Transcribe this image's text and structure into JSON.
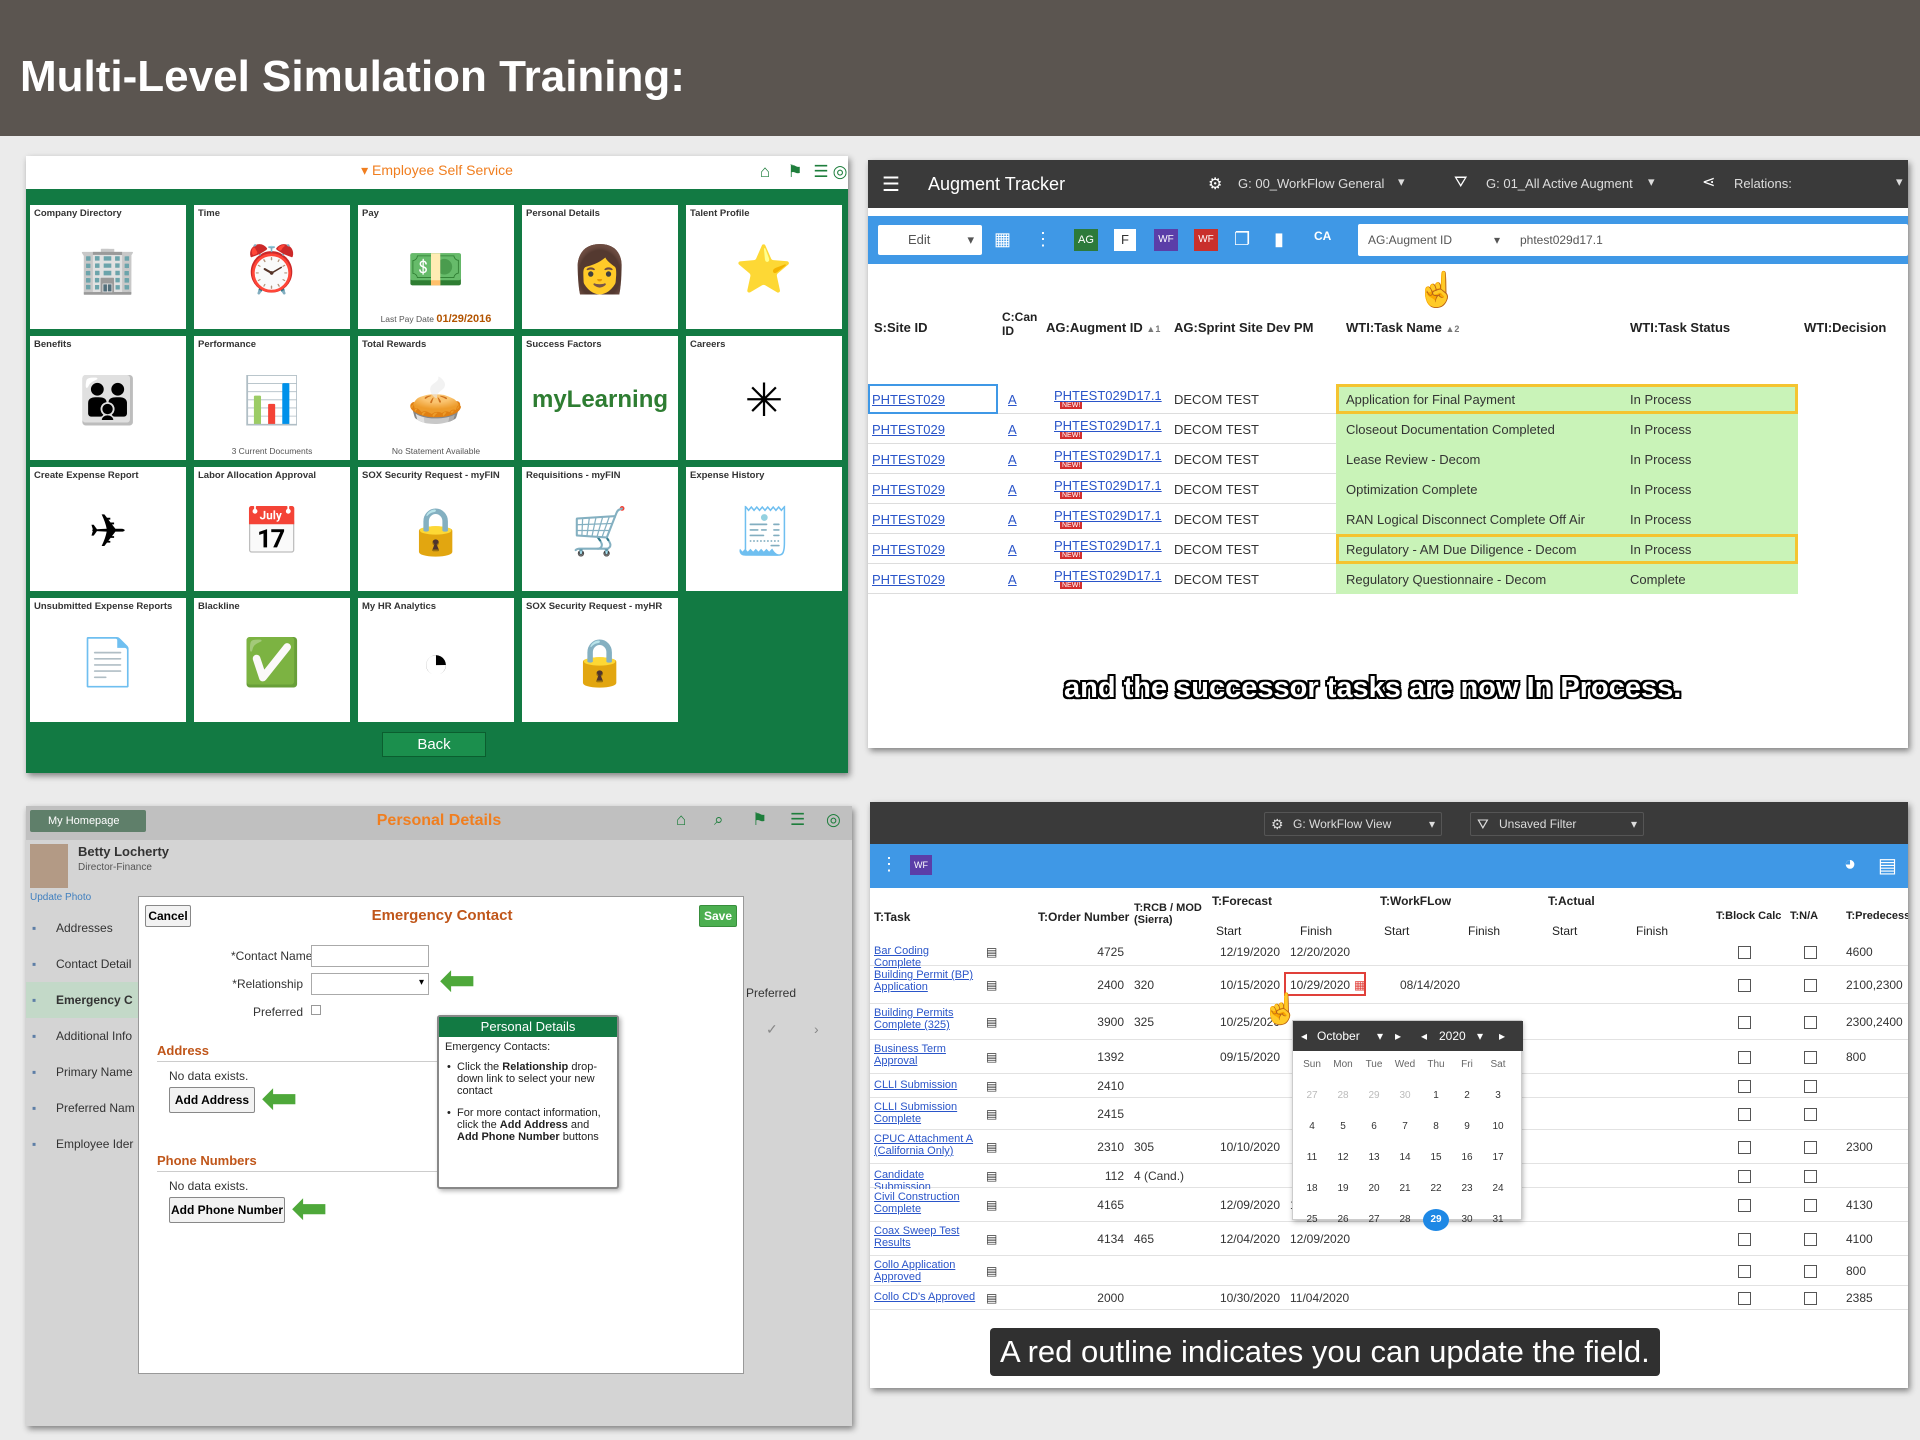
{
  "header": {
    "title": "Multi-Level Simulation Training:"
  },
  "p1": {
    "section_title": "▾ Employee Self Service",
    "header_icons": [
      "home-icon",
      "flag-icon",
      "menu-icon",
      "compass-icon"
    ],
    "tiles": [
      {
        "title": "Company Directory",
        "icon": "org-chart-icon",
        "glyph": "🏢"
      },
      {
        "title": "Time",
        "icon": "person-clock-icon",
        "glyph": "⏰"
      },
      {
        "title": "Pay",
        "icon": "money-icon",
        "glyph": "💵",
        "footer": "Last Pay Date",
        "footer_value": "01/29/2016"
      },
      {
        "title": "Personal Details",
        "icon": "photo-icon",
        "glyph": "👩"
      },
      {
        "title": "Talent Profile",
        "icon": "person-star-icon",
        "glyph": "⭐"
      },
      {
        "title": "Benefits",
        "icon": "benefits-icon",
        "glyph": "👪"
      },
      {
        "title": "Performance",
        "icon": "performance-icon",
        "glyph": "📊",
        "footer": "3 Current Documents"
      },
      {
        "title": "Total Rewards",
        "icon": "pie-chart-icon",
        "glyph": "🥧",
        "footer": "No Statement Available"
      },
      {
        "title": "Success Factors",
        "icon": "mylearning-logo",
        "glyph": "",
        "logo_text": "myLearning"
      },
      {
        "title": "Careers",
        "icon": "careers-icon",
        "glyph": "✳"
      },
      {
        "title": "Create Expense Report",
        "icon": "travel-icon",
        "glyph": "✈"
      },
      {
        "title": "Labor Allocation Approval",
        "icon": "calendar-icon",
        "glyph": "📅"
      },
      {
        "title": "SOX Security Request - myFIN",
        "icon": "lock-icon",
        "glyph": "🔒"
      },
      {
        "title": "Requisitions - myFIN",
        "icon": "cart-icon",
        "glyph": "🛒"
      },
      {
        "title": "Expense History",
        "icon": "expense-history-icon",
        "glyph": "🧾"
      },
      {
        "title": "Unsubmitted Expense Reports",
        "icon": "document-info-icon",
        "glyph": "📄"
      },
      {
        "title": "Blackline",
        "icon": "checklist-icon",
        "glyph": "✅"
      },
      {
        "title": "My HR Analytics",
        "icon": "pie-chart-icon",
        "glyph": "◔"
      },
      {
        "title": "SOX Security Request - myHR",
        "icon": "lock-icon",
        "glyph": "🔒"
      }
    ],
    "back_label": "Back"
  },
  "p2": {
    "app_title": "Augment Tracker",
    "view_dd": "G: 00_WorkFlow General",
    "filter_dd": "G: 01_All Active Augment",
    "relations_dd": "Relations:",
    "edit_label": "Edit",
    "search_field": "AG:Augment ID",
    "search_value": "phtest029d17.1",
    "columns": [
      "S:Site ID",
      "C:Can ID",
      "AG:Augment ID",
      "AG:Sprint Site Dev PM",
      "WTI:Task Name",
      "WTI:Task Status",
      "WTI:Decision"
    ],
    "sort_marks": {
      "augment": "▲1",
      "task": "▲2"
    },
    "new_badge": "NEW!",
    "rows": [
      {
        "site": "PHTEST029",
        "can": "A",
        "augment": "PHTEST029D17.1",
        "pm": "DECOM TEST",
        "task": "Application for Final Payment",
        "status": "In Process"
      },
      {
        "site": "PHTEST029",
        "can": "A",
        "augment": "PHTEST029D17.1",
        "pm": "DECOM TEST",
        "task": "Closeout Documentation Completed",
        "status": "In Process"
      },
      {
        "site": "PHTEST029",
        "can": "A",
        "augment": "PHTEST029D17.1",
        "pm": "DECOM TEST",
        "task": "Lease Review - Decom",
        "status": "In Process"
      },
      {
        "site": "PHTEST029",
        "can": "A",
        "augment": "PHTEST029D17.1",
        "pm": "DECOM TEST",
        "task": "Optimization Complete",
        "status": "In Process"
      },
      {
        "site": "PHTEST029",
        "can": "A",
        "augment": "PHTEST029D17.1",
        "pm": "DECOM TEST",
        "task": "RAN Logical Disconnect Complete Off Air",
        "status": "In Process"
      },
      {
        "site": "PHTEST029",
        "can": "A",
        "augment": "PHTEST029D17.1",
        "pm": "DECOM TEST",
        "task": "Regulatory - AM Due Diligence - Decom",
        "status": "In Process"
      },
      {
        "site": "PHTEST029",
        "can": "A",
        "augment": "PHTEST029D17.1",
        "pm": "DECOM TEST",
        "task": "Regulatory Questionnaire - Decom",
        "status": "Complete"
      }
    ],
    "caption": "and the successor tasks are now In Process."
  },
  "p3": {
    "homepage": "My Homepage",
    "page_title": "Personal Details",
    "user_name": "Betty Locherty",
    "user_title": "Director-Finance",
    "update_photo": "Update Photo",
    "nav": [
      "Addresses",
      "Contact Detail",
      "Emergency C",
      "Additional Info",
      "Primary Name",
      "Preferred Nam",
      "Employee Ider"
    ],
    "modal_title": "Emergency Contact",
    "cancel": "Cancel",
    "save": "Save",
    "contact_name_label": "*Contact Name",
    "relationship_label": "*Relationship",
    "preferred_label": "Preferred",
    "address_section": "Address",
    "no_data": "No data exists.",
    "add_address": "Add Address",
    "phone_section": "Phone Numbers",
    "add_phone": "Add Phone Number",
    "bg_preferred": "Preferred",
    "tip_title": "Personal Details",
    "tip_heading": "Emergency Contacts:",
    "tip_b1_pre": "Click the ",
    "tip_b1_bold": "Relationship",
    "tip_b1_post": " drop-down link to select your new contact",
    "tip_b2_pre": "For more contact information, click the ",
    "tip_b2_bold1": "Add Address",
    "tip_b2_mid": " and ",
    "tip_b2_bold2": "Add Phone Number",
    "tip_b2_post": " buttons"
  },
  "p4": {
    "view_dd": "G: WorkFlow View",
    "filter_dd": "Unsaved Filter",
    "col_task": "T:Task",
    "col_order": "T:Order Number",
    "col_rcb": "T:RCB / MOD (Sierra)",
    "grp_forecast": "T:Forecast",
    "grp_workflow": "T:WorkFLow",
    "grp_actual": "T:Actual",
    "sub_start": "Start",
    "sub_finish": "Finish",
    "col_block": "T:Block Calc",
    "col_na": "T:N/A",
    "col_pred": "T:Predecess",
    "rows": [
      {
        "task": "Bar Coding Complete",
        "order": "4725",
        "rcb": "",
        "fstart": "12/19/2020",
        "ffinish": "12/20/2020",
        "wstart": "",
        "pred": "4600"
      },
      {
        "task": "Building Permit (BP) Application",
        "order": "2400",
        "rcb": "320",
        "fstart": "10/15/2020",
        "ffinish": "10/29/2020",
        "wstart": "08/14/2020",
        "pred": "2100,2300"
      },
      {
        "task": "Building Permits Complete (325)",
        "order": "3900",
        "rcb": "325",
        "fstart": "10/25/2020",
        "ffinish": "",
        "wstart": "",
        "pred": "2300,2400"
      },
      {
        "task": "Business Term Approval",
        "order": "1392",
        "rcb": "",
        "fstart": "09/15/2020",
        "ffinish": "",
        "wstart": "",
        "pred": "800"
      },
      {
        "task": "CLLI Submission",
        "order": "2410",
        "rcb": "",
        "fstart": "",
        "ffinish": "",
        "wstart": "",
        "pred": ""
      },
      {
        "task": "CLLI Submission Complete",
        "order": "2415",
        "rcb": "",
        "fstart": "",
        "ffinish": "",
        "wstart": "",
        "pred": ""
      },
      {
        "task": "CPUC Attachment A (California Only)",
        "order": "2310",
        "rcb": "305",
        "fstart": "10/10/2020",
        "ffinish": "",
        "wstart": "",
        "pred": "2300"
      },
      {
        "task": "Candidate Submission",
        "order": "112",
        "rcb": "4 (Cand.)",
        "fstart": "",
        "ffinish": "",
        "wstart": "",
        "pred": ""
      },
      {
        "task": "Civil Construction Complete",
        "order": "4165",
        "rcb": "",
        "fstart": "12/09/2020",
        "ffinish": "12/09/2020",
        "wstart": "",
        "pred": "4130"
      },
      {
        "task": "Coax Sweep Test Results",
        "order": "4134",
        "rcb": "465",
        "fstart": "12/04/2020",
        "ffinish": "12/09/2020",
        "wstart": "",
        "pred": "4100"
      },
      {
        "task": "Collo Application Approved",
        "order": "",
        "rcb": "",
        "fstart": "",
        "ffinish": "",
        "wstart": "",
        "pred": "800"
      },
      {
        "task": "Collo CD's Approved",
        "order": "2000",
        "rcb": "",
        "fstart": "10/30/2020",
        "ffinish": "11/04/2020",
        "wstart": "",
        "pred": "2385"
      }
    ],
    "cal_month": "October",
    "cal_year": "2020",
    "cal_days": [
      "Sun",
      "Mon",
      "Tue",
      "Wed",
      "Thu",
      "Fri",
      "Sat"
    ],
    "cal_grid": [
      [
        "27",
        "28",
        "29",
        "30",
        "1",
        "2",
        "3"
      ],
      [
        "4",
        "5",
        "6",
        "7",
        "8",
        "9",
        "10"
      ],
      [
        "11",
        "12",
        "13",
        "14",
        "15",
        "16",
        "17"
      ],
      [
        "18",
        "19",
        "20",
        "21",
        "22",
        "23",
        "24"
      ],
      [
        "25",
        "26",
        "27",
        "28",
        "29",
        "30",
        "31"
      ]
    ],
    "cal_selected": "29",
    "caption": "A red outline indicates you can update the field."
  },
  "colors": {
    "header_bg": "#5b5550",
    "ess_green": "#127a43",
    "accent_orange": "#f07e1f",
    "toolbar_blue": "#3f98e6",
    "highlight_green": "#c9f3b8",
    "outline_yellow": "#f4c430",
    "outline_red": "#e0403a",
    "arrow_green": "#4ea83a"
  }
}
